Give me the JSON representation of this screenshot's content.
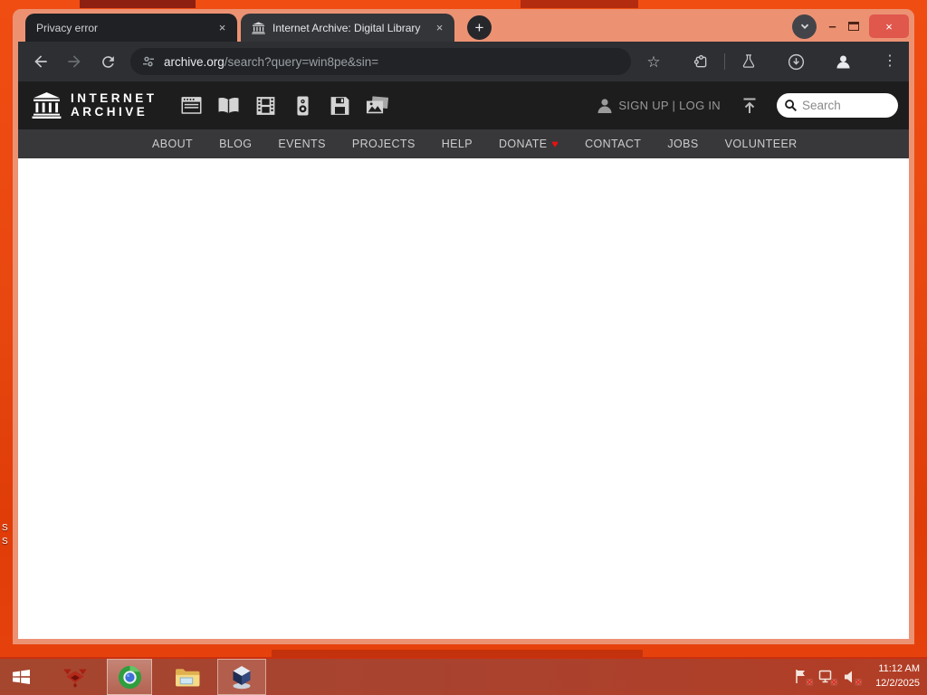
{
  "browser": {
    "tabs": [
      {
        "title": "Privacy error"
      },
      {
        "title": "Internet Archive: Digital Library"
      }
    ],
    "url_domain": "archive.org",
    "url_path": "/search?query=win8pe&sin="
  },
  "archive": {
    "logo_line1": "INTERNET",
    "logo_line2": "ARCHIVE",
    "media_icons": [
      "web-icon",
      "texts-icon",
      "video-icon",
      "audio-icon",
      "software-icon",
      "images-icon"
    ],
    "account": "SIGN UP | LOG IN",
    "search_placeholder": "Search",
    "nav": [
      "ABOUT",
      "BLOG",
      "EVENTS",
      "PROJECTS",
      "HELP",
      "DONATE",
      "CONTACT",
      "JOBS",
      "VOLUNTEER"
    ]
  },
  "taskbar": {
    "time": "11:12 AM",
    "date": "12/2/2025",
    "apps": [
      "start-button",
      "red-app",
      "chromium-browser",
      "file-explorer",
      "virtualbox"
    ]
  },
  "desktop": {
    "fragments": [
      "S",
      "S"
    ]
  },
  "glyphs": {
    "close": "×",
    "new_tab": "+",
    "minimize": "–",
    "menu": "⋮",
    "star": "☆",
    "heart": "♥",
    "tray_x": "✕"
  },
  "colors": {
    "desktop": "#e8470f",
    "window_frame": "#ec9273",
    "toolbar": "#2e2f32",
    "archive_header": "#1d1d1d",
    "archive_navbar": "#38383b",
    "taskbar": "#a84330",
    "close_button": "#e0574c",
    "heart": "#f10e0e"
  }
}
